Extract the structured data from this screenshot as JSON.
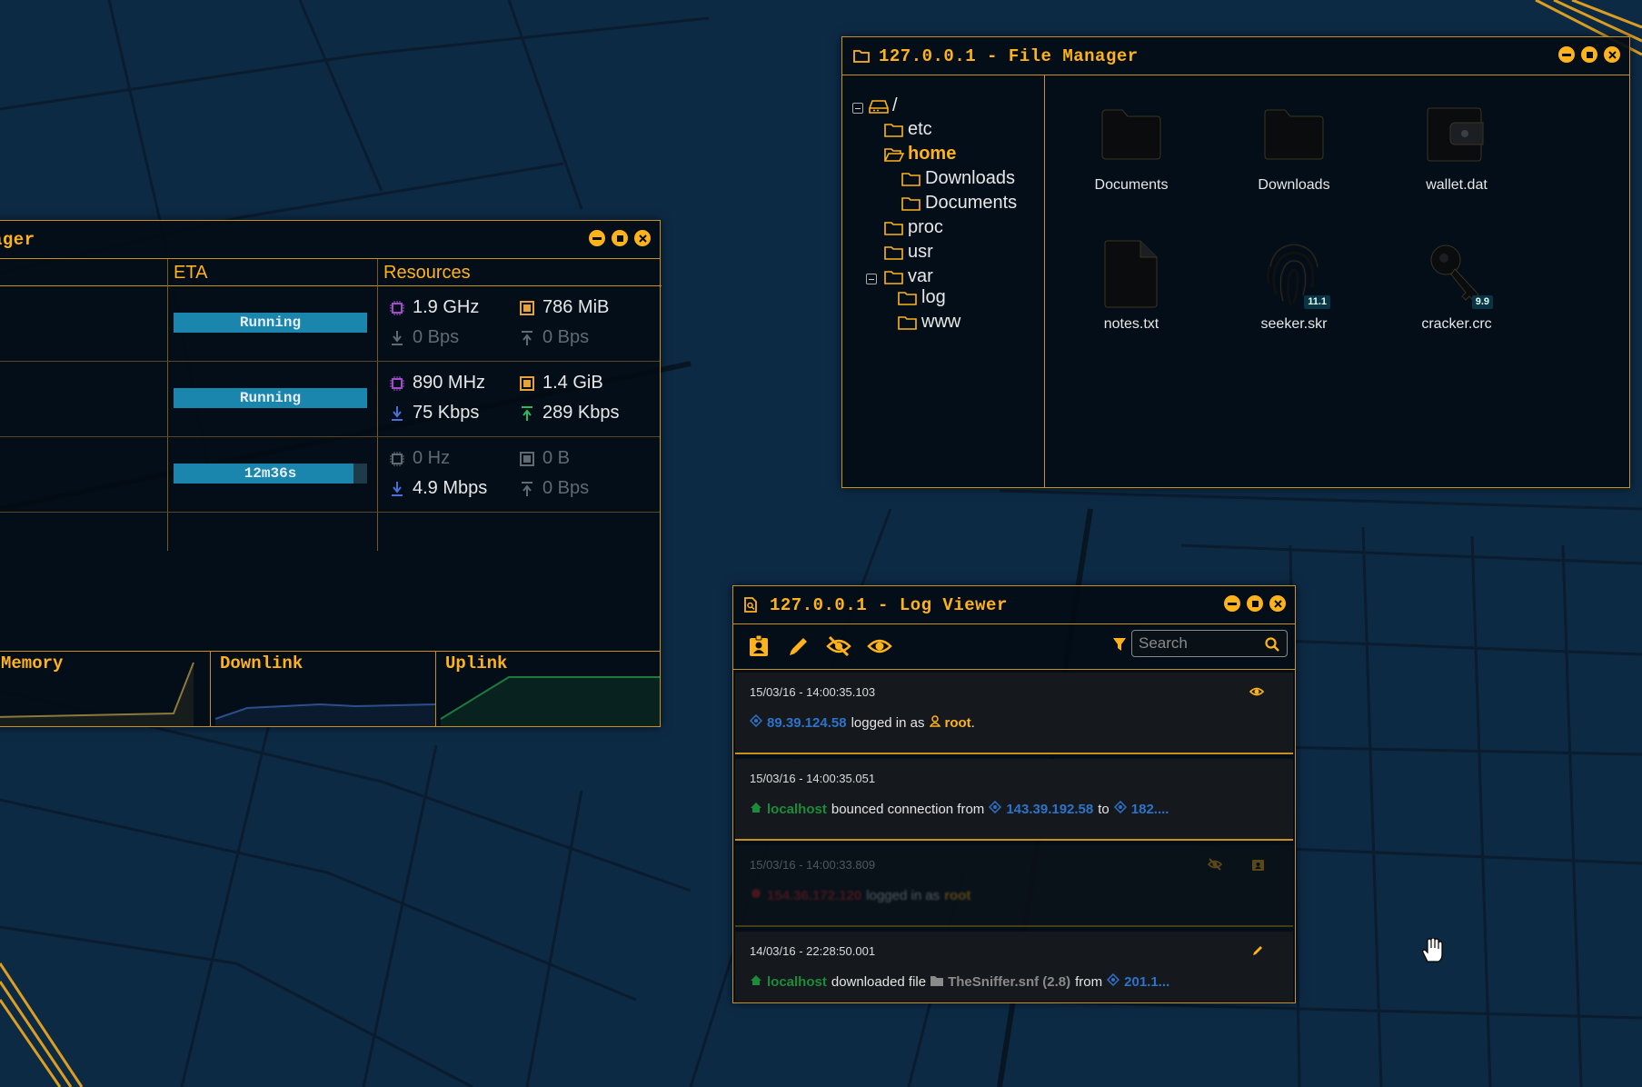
{
  "colors": {
    "accent": "#ffb31a",
    "background": "#0d2a45",
    "progress": "#1a85ad",
    "ip": "#2e72c9",
    "host": "#1d8c3a"
  },
  "process_manager": {
    "title_fragment": "ager",
    "columns": {
      "eta": "ETA",
      "resources": "Resources"
    },
    "rows": [
      {
        "status": "Running",
        "progress": 1.0,
        "cpu": "1.9 GHz",
        "mem": "786 MiB",
        "down": "0 Bps",
        "up": "0 Bps"
      },
      {
        "status": "Running",
        "progress": 1.0,
        "cpu": "890 MHz",
        "mem": "1.4 GiB",
        "down": "75 Kbps",
        "up": "289 Kbps"
      },
      {
        "status": "12m36s",
        "progress": 0.93,
        "cpu": "0 Hz",
        "mem": "0 B",
        "down": "4.9 Mbps",
        "up": "0 Bps"
      }
    ],
    "graphs": {
      "memory": "Memory",
      "downlink": "Downlink",
      "uplink": "Uplink"
    },
    "window_controls": [
      "minimize-icon",
      "maximize-icon",
      "close-icon"
    ]
  },
  "file_manager": {
    "title": "127.0.0.1 - File Manager",
    "tree": {
      "root": "/",
      "etc": "etc",
      "home": "home",
      "downloads": "Downloads",
      "documents": "Documents",
      "proc": "proc",
      "usr": "usr",
      "var": "var",
      "log": "log",
      "www": "www"
    },
    "files": [
      {
        "name": "Documents",
        "icon": "folder-icon"
      },
      {
        "name": "Downloads",
        "icon": "folder-icon"
      },
      {
        "name": "wallet.dat",
        "icon": "wallet-icon"
      },
      {
        "name": "notes.txt",
        "icon": "file-icon"
      },
      {
        "name": "seeker.skr",
        "icon": "fingerprint-icon",
        "badge": "11.1"
      },
      {
        "name": "cracker.crc",
        "icon": "key-icon",
        "badge": "9.9"
      }
    ]
  },
  "log_viewer": {
    "title": "127.0.0.1 - Log Viewer",
    "toolbar": {
      "buttons": [
        "user-badge-icon",
        "pencil-icon",
        "eye-slash-icon",
        "eye-icon"
      ],
      "filter_icon": "filter-icon"
    },
    "search": {
      "placeholder": "Search"
    },
    "entries": [
      {
        "timestamp": "15/03/16 - 14:00:35.103",
        "ip": "89.39.124.58",
        "text1": "logged in as",
        "user": "root",
        "text2": "."
      },
      {
        "timestamp": "15/03/16 - 14:00:35.051",
        "host": "localhost",
        "text1": "bounced connection from",
        "ip1": "143.39.192.58",
        "text2": "to",
        "ip2": "182...."
      },
      {
        "timestamp": "15/03/16 - 14:00:33.809",
        "ip": "154.36.172.120",
        "text1": "logged in as",
        "user": "root"
      },
      {
        "timestamp": "14/03/16 - 22:28:50.001",
        "host": "localhost",
        "text1": "downloaded file",
        "file": "TheSniffer.snf (2.8)",
        "text2": "from",
        "ip": "201.1..."
      }
    ]
  }
}
